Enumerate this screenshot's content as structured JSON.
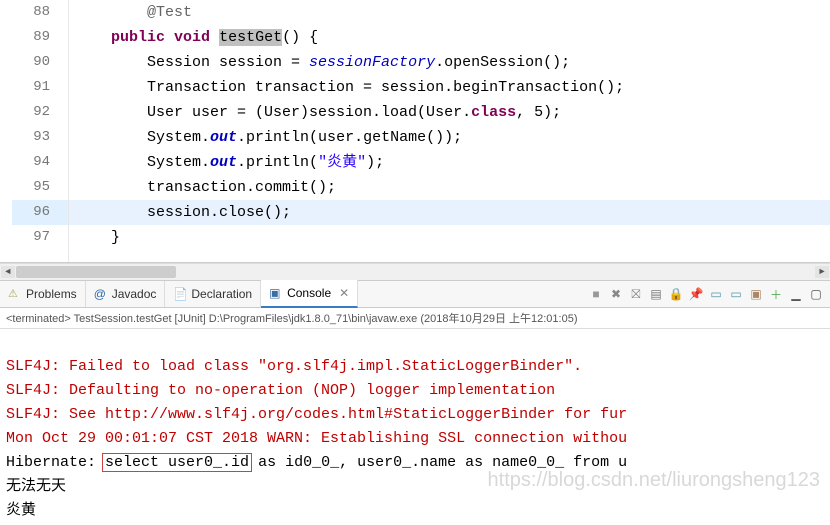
{
  "editor": {
    "line_numbers": [
      "88",
      "89",
      "90",
      "91",
      "92",
      "93",
      "94",
      "95",
      "96",
      "97"
    ],
    "line88_annotation": "@Test",
    "line89": {
      "kw_public": "public",
      "kw_void": "void",
      "method": "testGet",
      "rest": "() {"
    },
    "line90": {
      "a": "Session session = ",
      "field": "sessionFactory",
      "b": ".openSession();"
    },
    "line91": {
      "a": "Transaction transaction = session.beginTransaction();"
    },
    "line92": {
      "a": "User user = (User)session.load(User.",
      "kw": "class",
      "b": ", 5);"
    },
    "line93": {
      "a": "System.",
      "out": "out",
      "b": ".println(user.getName());"
    },
    "line94": {
      "a": "System.",
      "out": "out",
      "b": ".println(",
      "str": "\"炎黄\"",
      "c": ");"
    },
    "line95": {
      "a": "transaction.commit();"
    },
    "line96": {
      "a": "session.close();"
    },
    "line97": {
      "a": "}"
    }
  },
  "tabs": {
    "problems": "Problems",
    "javadoc": "Javadoc",
    "declaration": "Declaration",
    "console": "Console"
  },
  "terminated": "<terminated> TestSession.testGet [JUnit] D:\\ProgramFiles\\jdk1.8.0_71\\bin\\javaw.exe (2018年10月29日 上午12:01:05)",
  "console": {
    "l1": "SLF4J: Failed to load class \"org.slf4j.impl.StaticLoggerBinder\".",
    "l2": "SLF4J: Defaulting to no-operation (NOP) logger implementation",
    "l3": "SLF4J: See http://www.slf4j.org/codes.html#StaticLoggerBinder for fur",
    "l4": "Mon Oct 29 00:01:07 CST 2018 WARN: Establishing SSL connection withou",
    "l5_a": "Hibernate: ",
    "l5_boxed": "select user0_.id",
    "l5_b": " as id0_0_, user0_.name as name0_0_ from u",
    "l6": "无法无天",
    "l7": "炎黄"
  },
  "watermark": "https://blog.csdn.net/liurongsheng123"
}
